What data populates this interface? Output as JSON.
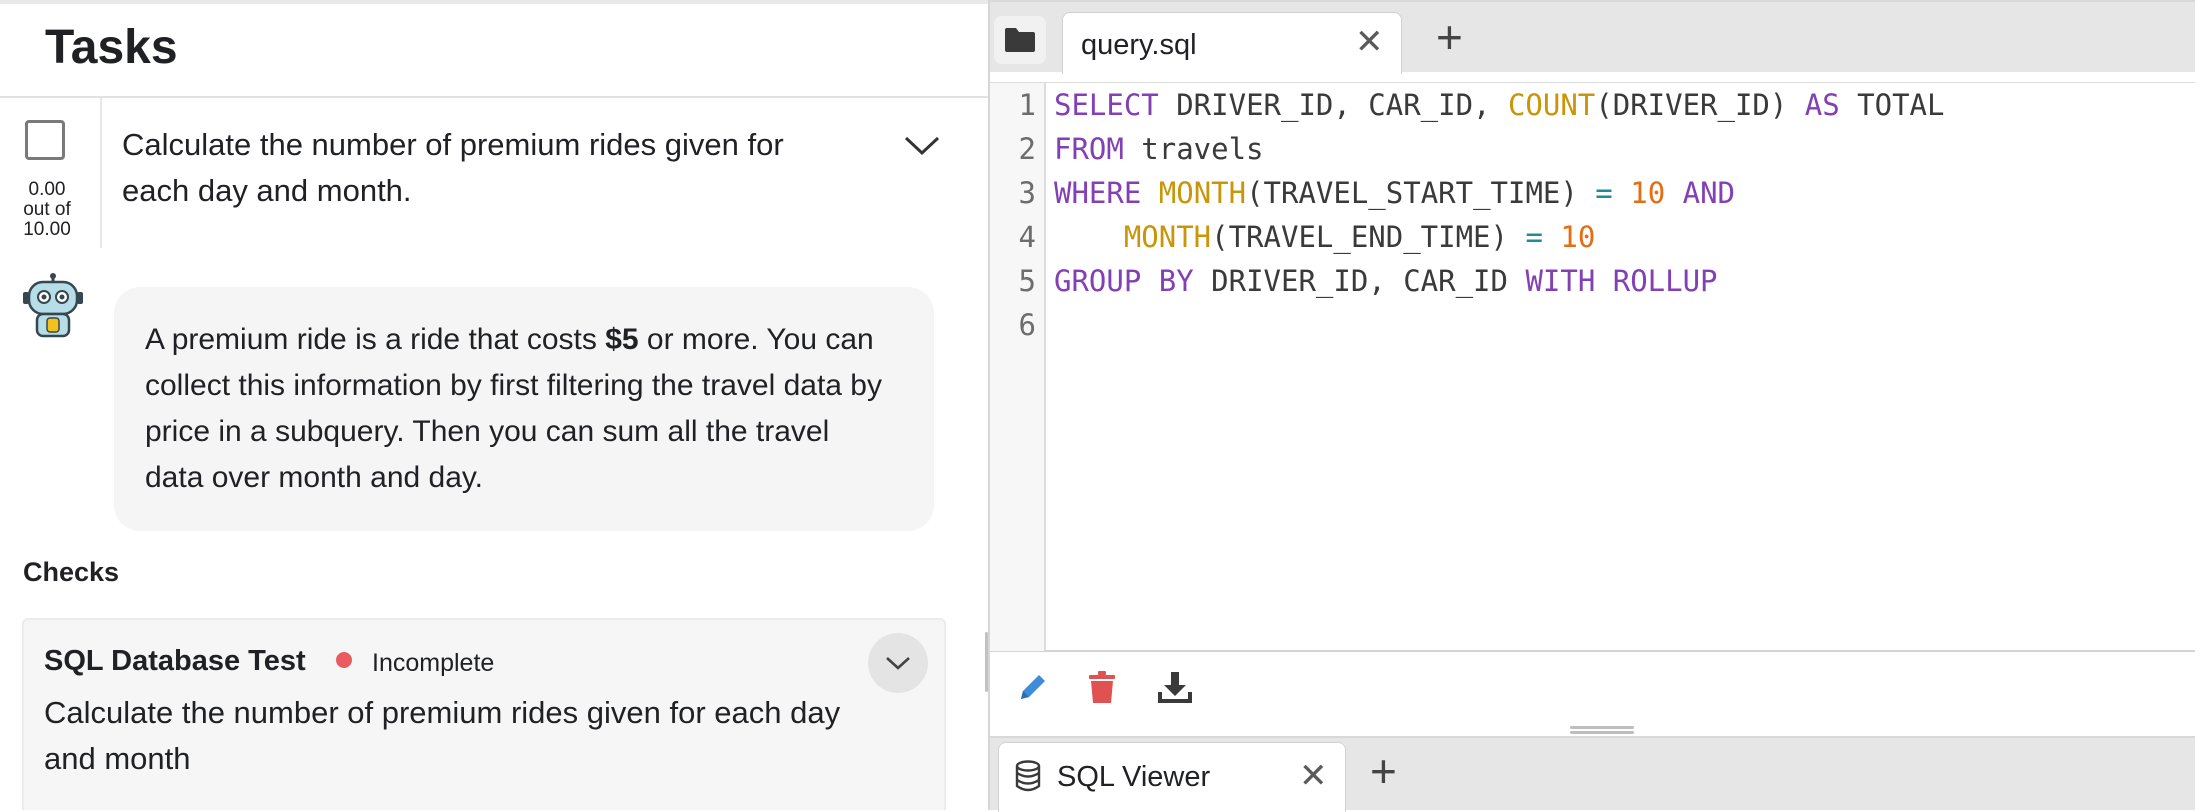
{
  "tasks": {
    "title": "Tasks",
    "task": {
      "score": "0.00",
      "score_out_of": "out of",
      "score_max": "10.00",
      "text": "Calculate the number of premium rides given for each day and month."
    },
    "hint": {
      "part1": "A premium ride is a ride that costs ",
      "bold": "$5",
      "part2": " or more. You can collect this information by first filtering the travel data by price in a subquery. Then you can sum all the travel data over month and day."
    },
    "checks_label": "Checks",
    "check": {
      "title": "SQL Database Test",
      "status": "Incomplete",
      "status_color": "#e85c61",
      "description": "Calculate the number of premium rides given for each day and month"
    }
  },
  "editor": {
    "tab_label": "query.sql",
    "line_numbers": [
      "1",
      "2",
      "3",
      "4",
      "5",
      "6"
    ],
    "code": {
      "l1": {
        "kw1": "SELECT",
        "t1": " DRIVER_ID, CAR_ID, ",
        "fn1": "COUNT",
        "t2": "(DRIVER_ID) ",
        "kw2": "AS",
        "t3": " TOTAL"
      },
      "l2": {
        "kw1": "FROM",
        "t1": " travels"
      },
      "l3": {
        "kw1": "WHERE",
        "fn1": "MONTH",
        "t1": "(TRAVEL_START_TIME) ",
        "op1": "=",
        "num1": "10",
        "kw2": "AND"
      },
      "l4": {
        "fn1": "MONTH",
        "t1": "(TRAVEL_END_TIME) ",
        "op1": "=",
        "num1": "10"
      },
      "l5": {
        "kw1": "GROUP",
        "kw2": "BY",
        "t1": " DRIVER_ID, CAR_ID ",
        "kw3": "WITH",
        "kw4": "ROLLUP"
      }
    },
    "colors": {
      "keyword": "#8340b4",
      "function": "#c9960a",
      "number": "#e56d12",
      "operator": "#1b8f98"
    },
    "toolbar_icons": [
      "pencil-icon",
      "trash-icon",
      "download-icon"
    ]
  },
  "viewer": {
    "tab_label": "SQL Viewer"
  }
}
